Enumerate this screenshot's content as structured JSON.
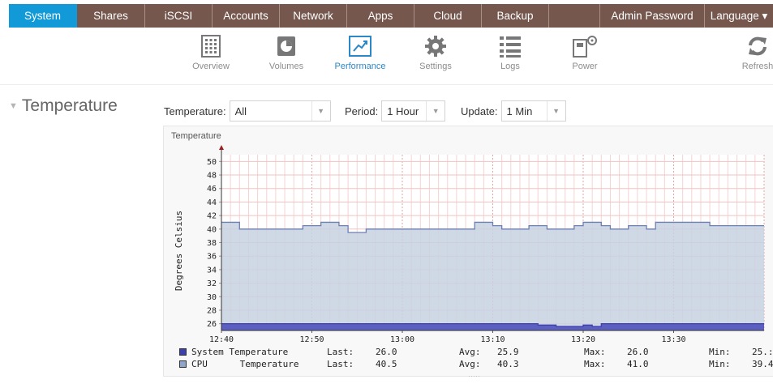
{
  "nav": {
    "tabs": [
      {
        "label": "System",
        "active": true
      },
      {
        "label": "Shares"
      },
      {
        "label": "iSCSI"
      },
      {
        "label": "Accounts"
      },
      {
        "label": "Network"
      },
      {
        "label": "Apps"
      },
      {
        "label": "Cloud"
      },
      {
        "label": "Backup"
      },
      {
        "label": ""
      },
      {
        "label": "Admin Password"
      },
      {
        "label": "Language ▾"
      }
    ]
  },
  "subnav": {
    "items": [
      {
        "label": "Overview",
        "icon": "overview-grid-icon"
      },
      {
        "label": "Volumes",
        "icon": "volumes-pie-icon"
      },
      {
        "label": "Performance",
        "icon": "performance-chart-icon",
        "active": true
      },
      {
        "label": "Settings",
        "icon": "settings-gear-icon"
      },
      {
        "label": "Logs",
        "icon": "logs-list-icon"
      },
      {
        "label": "Power",
        "icon": "power-icon"
      },
      {
        "label": "Refresh",
        "icon": "refresh-icon"
      }
    ]
  },
  "section": {
    "title": "Temperature"
  },
  "controls": {
    "temperature_label": "Temperature:",
    "temperature_value": "All",
    "period_label": "Period:",
    "period_value": "1 Hour",
    "update_label": "Update:",
    "update_value": "1 Min"
  },
  "colors": {
    "accent": "#1199d8",
    "nav_bg": "#75574e",
    "cpu_fill": "#c7d2e0",
    "cpu_line": "#6e7fb4",
    "system_fill": "#4b50b8",
    "grid": "#f0b8b8"
  },
  "chart_data": {
    "type": "area",
    "title": "Temperature",
    "ylabel": "Degrees Celsius",
    "ylim": [
      25,
      51
    ],
    "yticks": [
      26,
      28,
      30,
      32,
      34,
      36,
      38,
      40,
      42,
      44,
      46,
      48,
      50
    ],
    "xticks": [
      "12:40",
      "12:50",
      "13:00",
      "13:10",
      "13:20",
      "13:30"
    ],
    "x_minutes_start": "12:40",
    "series": [
      {
        "name": "CPU Temperature",
        "values": [
          41,
          41,
          40,
          40,
          40,
          40,
          40,
          40,
          40,
          40.5,
          40.5,
          41,
          41,
          40.5,
          39.5,
          39.5,
          40,
          40,
          40,
          40,
          40,
          40,
          40,
          40,
          40,
          40,
          40,
          40,
          41,
          41,
          40.5,
          40,
          40,
          40,
          40.5,
          40.5,
          40,
          40,
          40,
          40.5,
          41,
          41,
          40.5,
          40,
          40,
          40.5,
          40.5,
          40,
          41,
          41,
          41,
          41,
          41,
          41,
          40.5,
          40.5,
          40.5,
          40.5,
          40.5,
          40.5,
          40.5
        ]
      },
      {
        "name": "System Temperature",
        "values": [
          26,
          26,
          26,
          26,
          26,
          26,
          26,
          26,
          26,
          26,
          26,
          26,
          26,
          26,
          26,
          26,
          26,
          26,
          26,
          26,
          26,
          26,
          26,
          26,
          26,
          26,
          26,
          26,
          26,
          26,
          26,
          26,
          26,
          26,
          26,
          25.8,
          25.8,
          25.6,
          25.6,
          25.6,
          25.8,
          25.6,
          26,
          26,
          26,
          26,
          26,
          26,
          26,
          26,
          26,
          26,
          26,
          26,
          26,
          26,
          26,
          26,
          26,
          26,
          26
        ]
      }
    ],
    "legend": [
      {
        "name": "System Temperature",
        "last_label": "Last:",
        "last": "26.0",
        "avg_label": "Avg:",
        "avg": "25.9",
        "max_label": "Max:",
        "max": "26.0",
        "min_label": "Min:",
        "min": "25.:"
      },
      {
        "name": "CPU      Temperature",
        "last_label": "Last:",
        "last": "40.5",
        "avg_label": "Avg:",
        "avg": "40.3",
        "max_label": "Max:",
        "max": "41.0",
        "min_label": "Min:",
        "min": "39.4"
      }
    ]
  }
}
